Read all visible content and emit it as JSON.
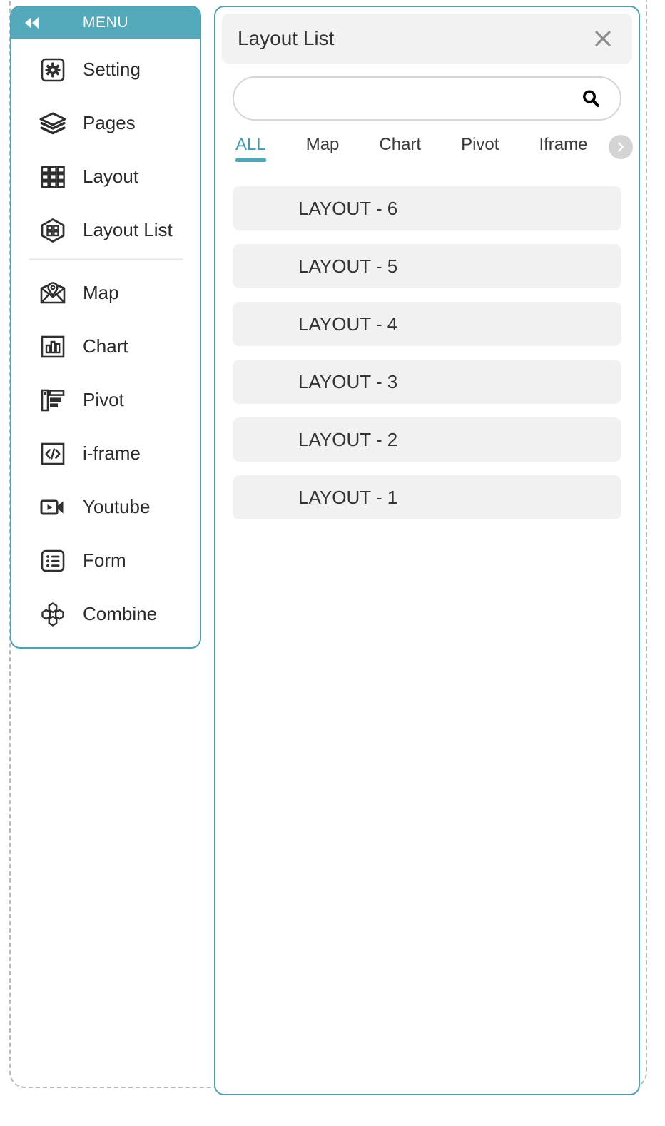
{
  "sidebar": {
    "header": {
      "title": "MENU",
      "collapse_icon": "double-chevron-left-icon"
    },
    "groups": [
      {
        "items": [
          {
            "label": "Setting",
            "icon": "gear-square-icon"
          },
          {
            "label": "Pages",
            "icon": "layers-icon"
          },
          {
            "label": "Layout",
            "icon": "grid-icon"
          },
          {
            "label": "Layout List",
            "icon": "hex-grid-icon"
          }
        ]
      },
      {
        "items": [
          {
            "label": "Map",
            "icon": "map-pin-icon"
          },
          {
            "label": "Chart",
            "icon": "bar-chart-icon"
          },
          {
            "label": "Pivot",
            "icon": "pivot-table-icon"
          },
          {
            "label": "i-frame",
            "icon": "code-brackets-icon"
          },
          {
            "label": "Youtube",
            "icon": "video-play-icon"
          },
          {
            "label": "Form",
            "icon": "list-form-icon"
          },
          {
            "label": "Combine",
            "icon": "combine-hexagons-icon"
          }
        ]
      }
    ]
  },
  "panel": {
    "title": "Layout List",
    "close_icon": "close-icon",
    "search": {
      "value": "",
      "placeholder": "",
      "icon": "search-icon"
    },
    "tabs": {
      "items": [
        {
          "label": "ALL",
          "active": true
        },
        {
          "label": "Map",
          "active": false
        },
        {
          "label": "Chart",
          "active": false
        },
        {
          "label": "Pivot",
          "active": false
        },
        {
          "label": "Iframe",
          "active": false
        }
      ],
      "next_icon": "chevron-right-circle-icon"
    },
    "list": [
      {
        "label": "LAYOUT - 6"
      },
      {
        "label": "LAYOUT - 5"
      },
      {
        "label": "LAYOUT - 4"
      },
      {
        "label": "LAYOUT - 3"
      },
      {
        "label": "LAYOUT - 2"
      },
      {
        "label": "LAYOUT - 1"
      }
    ]
  },
  "colors": {
    "accent": "#53a9ba",
    "accent_border": "#4aa3b4",
    "tab_active": "#3f9bb0",
    "item_bg": "#f1f1f1",
    "header_bg": "#f2f2f2",
    "canvas_dash": "#b9b9b9"
  }
}
